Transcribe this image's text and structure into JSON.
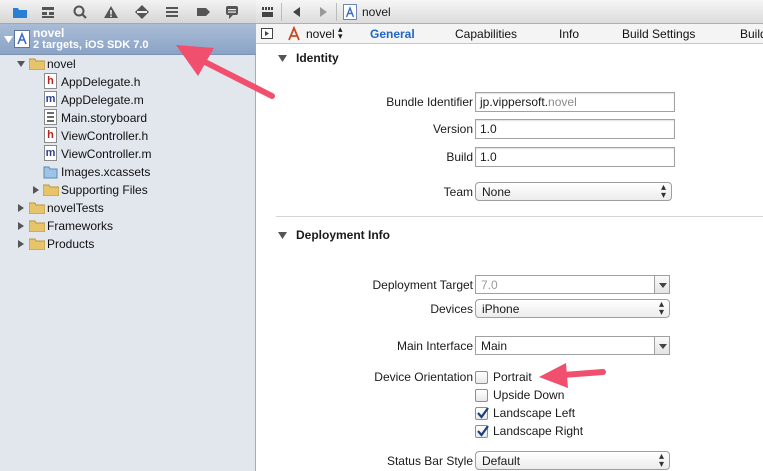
{
  "navigator": {
    "toolbar_icons": [
      "folder-icon",
      "hierarchy-icon",
      "search-icon",
      "warning-icon",
      "diamond-icon",
      "list-icon",
      "breakpoint-icon",
      "log-icon"
    ],
    "project": {
      "name": "novel",
      "subtitle": "2 targets, iOS SDK 7.0"
    },
    "tree": [
      {
        "label": "novel",
        "kind": "folder",
        "expanded": true
      },
      {
        "label": "AppDelegate.h",
        "kind": "h"
      },
      {
        "label": "AppDelegate.m",
        "kind": "m"
      },
      {
        "label": "Main.storyboard",
        "kind": "storyboard"
      },
      {
        "label": "ViewController.h",
        "kind": "h"
      },
      {
        "label": "ViewController.m",
        "kind": "m"
      },
      {
        "label": "Images.xcassets",
        "kind": "assets"
      },
      {
        "label": "Supporting Files",
        "kind": "folder",
        "expanded": false
      },
      {
        "label": "novelTests",
        "kind": "folder",
        "expanded": false
      },
      {
        "label": "Frameworks",
        "kind": "folder",
        "expanded": false
      },
      {
        "label": "Products",
        "kind": "folder",
        "expanded": false
      }
    ]
  },
  "jumpbar": {
    "crumb": "novel"
  },
  "tabs": {
    "target": "novel",
    "items": [
      "General",
      "Capabilities",
      "Info",
      "Build Settings",
      "Build"
    ],
    "active": "General"
  },
  "identity": {
    "header": "Identity",
    "bundle_id_label": "Bundle Identifier",
    "bundle_id_prefix": "jp.vippersoft.",
    "bundle_id_suffix": "novel",
    "version_label": "Version",
    "version_value": "1.0",
    "build_label": "Build",
    "build_value": "1.0",
    "team_label": "Team",
    "team_value": "None"
  },
  "deployment": {
    "header": "Deployment Info",
    "target_label": "Deployment Target",
    "target_value": "7.0",
    "devices_label": "Devices",
    "devices_value": "iPhone",
    "main_interface_label": "Main Interface",
    "main_interface_value": "Main",
    "orientation_label": "Device Orientation",
    "orientations": [
      {
        "label": "Portrait",
        "checked": false
      },
      {
        "label": "Upside Down",
        "checked": false
      },
      {
        "label": "Landscape Left",
        "checked": true
      },
      {
        "label": "Landscape Right",
        "checked": true
      }
    ],
    "status_bar_label": "Status Bar Style",
    "status_bar_value": "Default"
  },
  "colors": {
    "annotation_arrow": "#f0506e",
    "active_tab": "#1f66c9",
    "selection": "#8aa3c6"
  }
}
